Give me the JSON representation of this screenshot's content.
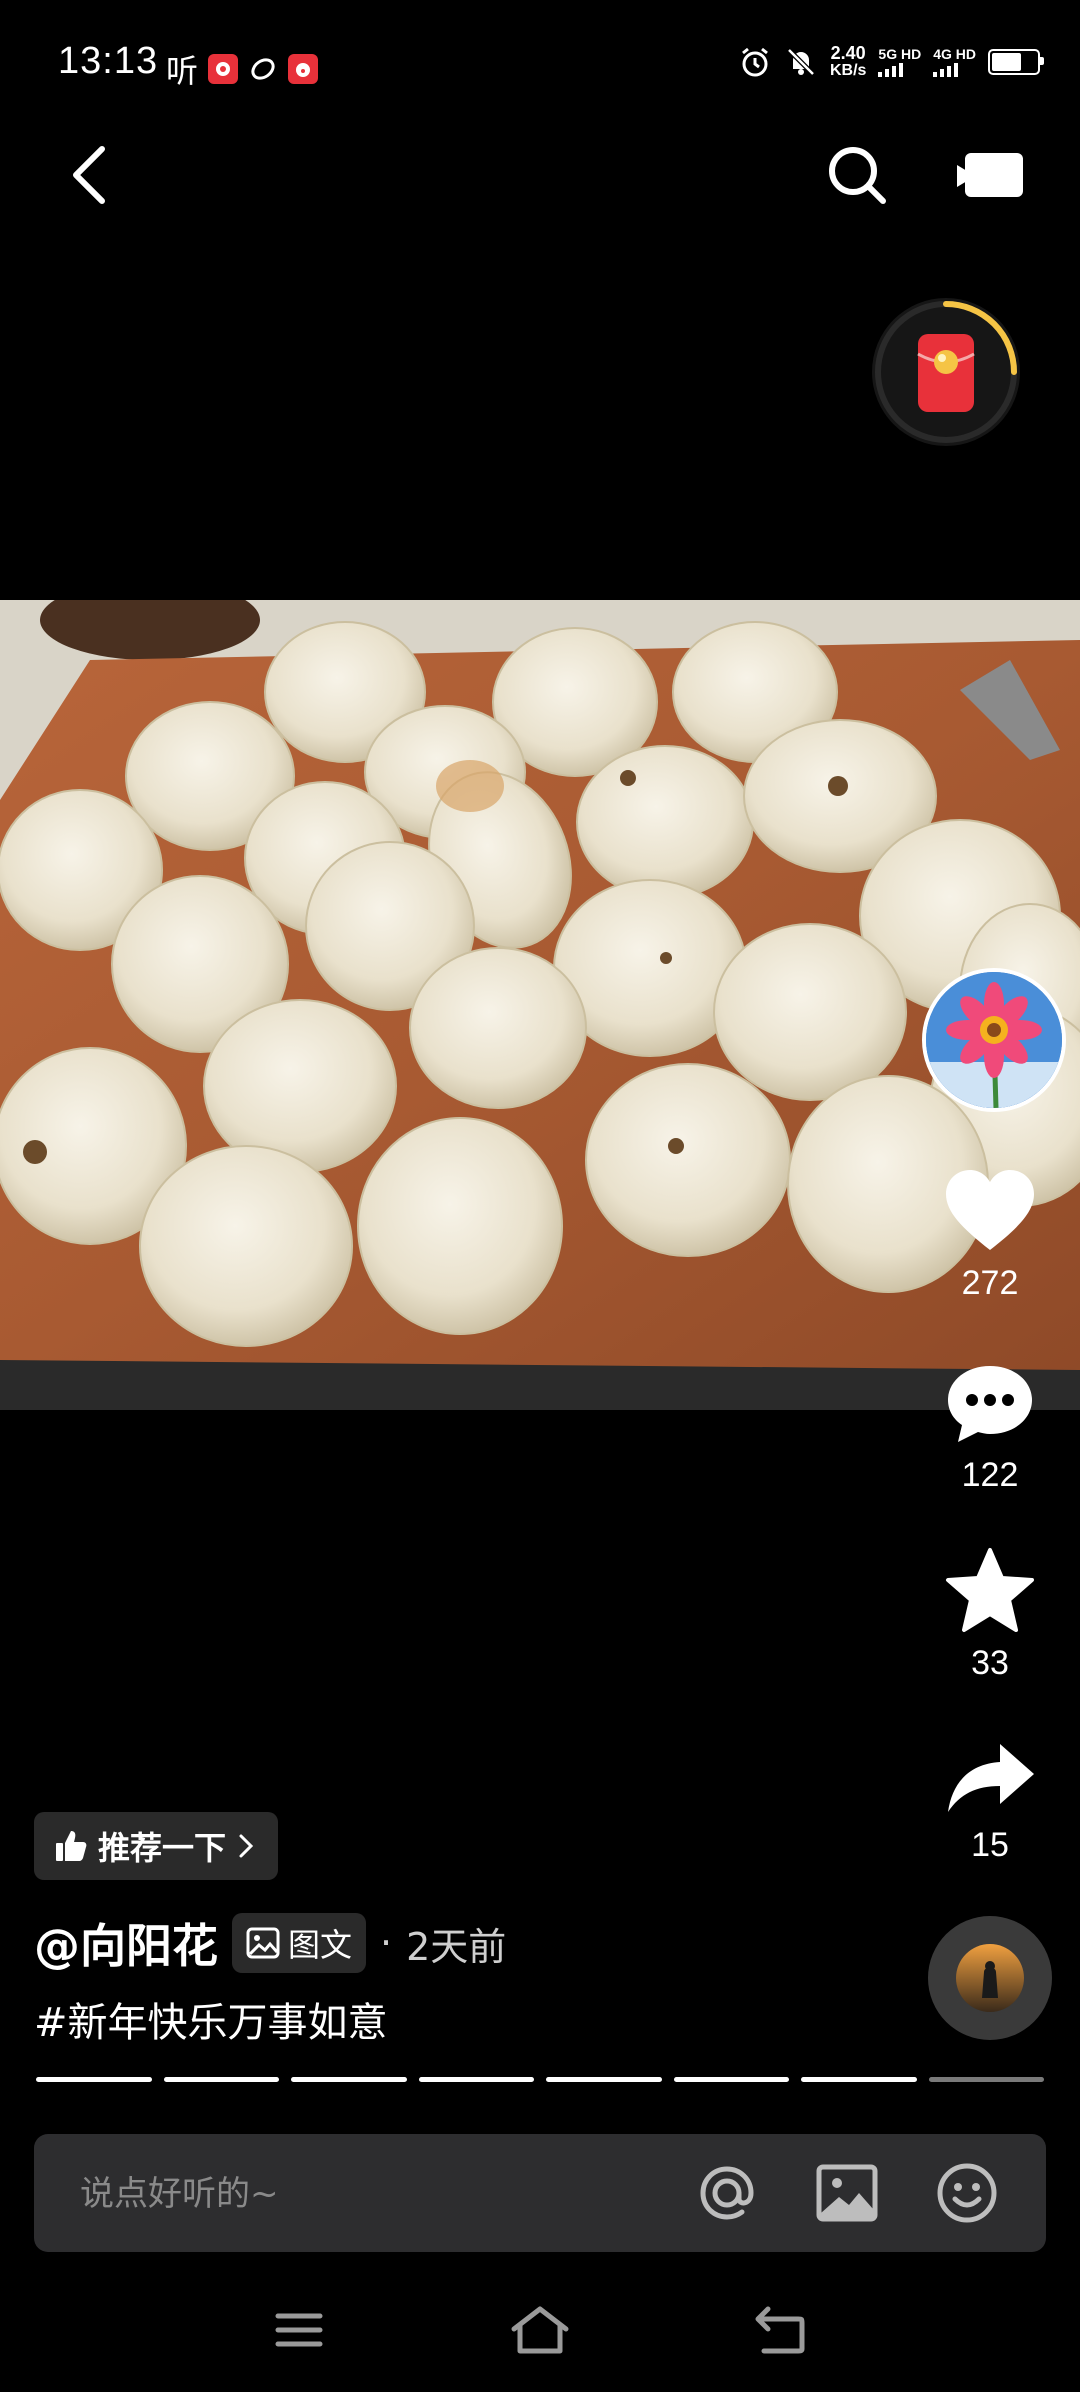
{
  "status_bar": {
    "time": "13:13",
    "listen_glyph": "听",
    "app_icons": [
      "app-icon-red",
      "app-icon-ring",
      "app-icon-clown"
    ],
    "net_speed": "2.40",
    "net_speed_unit": "KB/s",
    "sim1": "5G HD",
    "sim2": "4G HD",
    "battery_level": 0.6
  },
  "nav": {
    "back_icon": "chevron-left-icon",
    "search_icon": "search-icon",
    "camera_icon": "video-camera-icon"
  },
  "reward_widget": {
    "icon": "red-packet-icon",
    "progress": 0.25
  },
  "actions": {
    "likes": "272",
    "comments": "122",
    "favorites": "33",
    "shares": "15"
  },
  "post": {
    "recommend_label": "推荐一下",
    "author": "@向阳花",
    "type_label": "图文",
    "time_sep": "·",
    "time_ago": "2天前",
    "hashtag": "#新年快乐万事如意",
    "image_count": 8,
    "current_image": 7
  },
  "comment": {
    "placeholder": "说点好听的~"
  },
  "colors": {
    "background": "#000000",
    "pill_bg": "#2a2a2a",
    "comment_bar_bg": "#2d2d2f",
    "red_packet": "#e8313a",
    "progress_ring": "#f5c445"
  }
}
